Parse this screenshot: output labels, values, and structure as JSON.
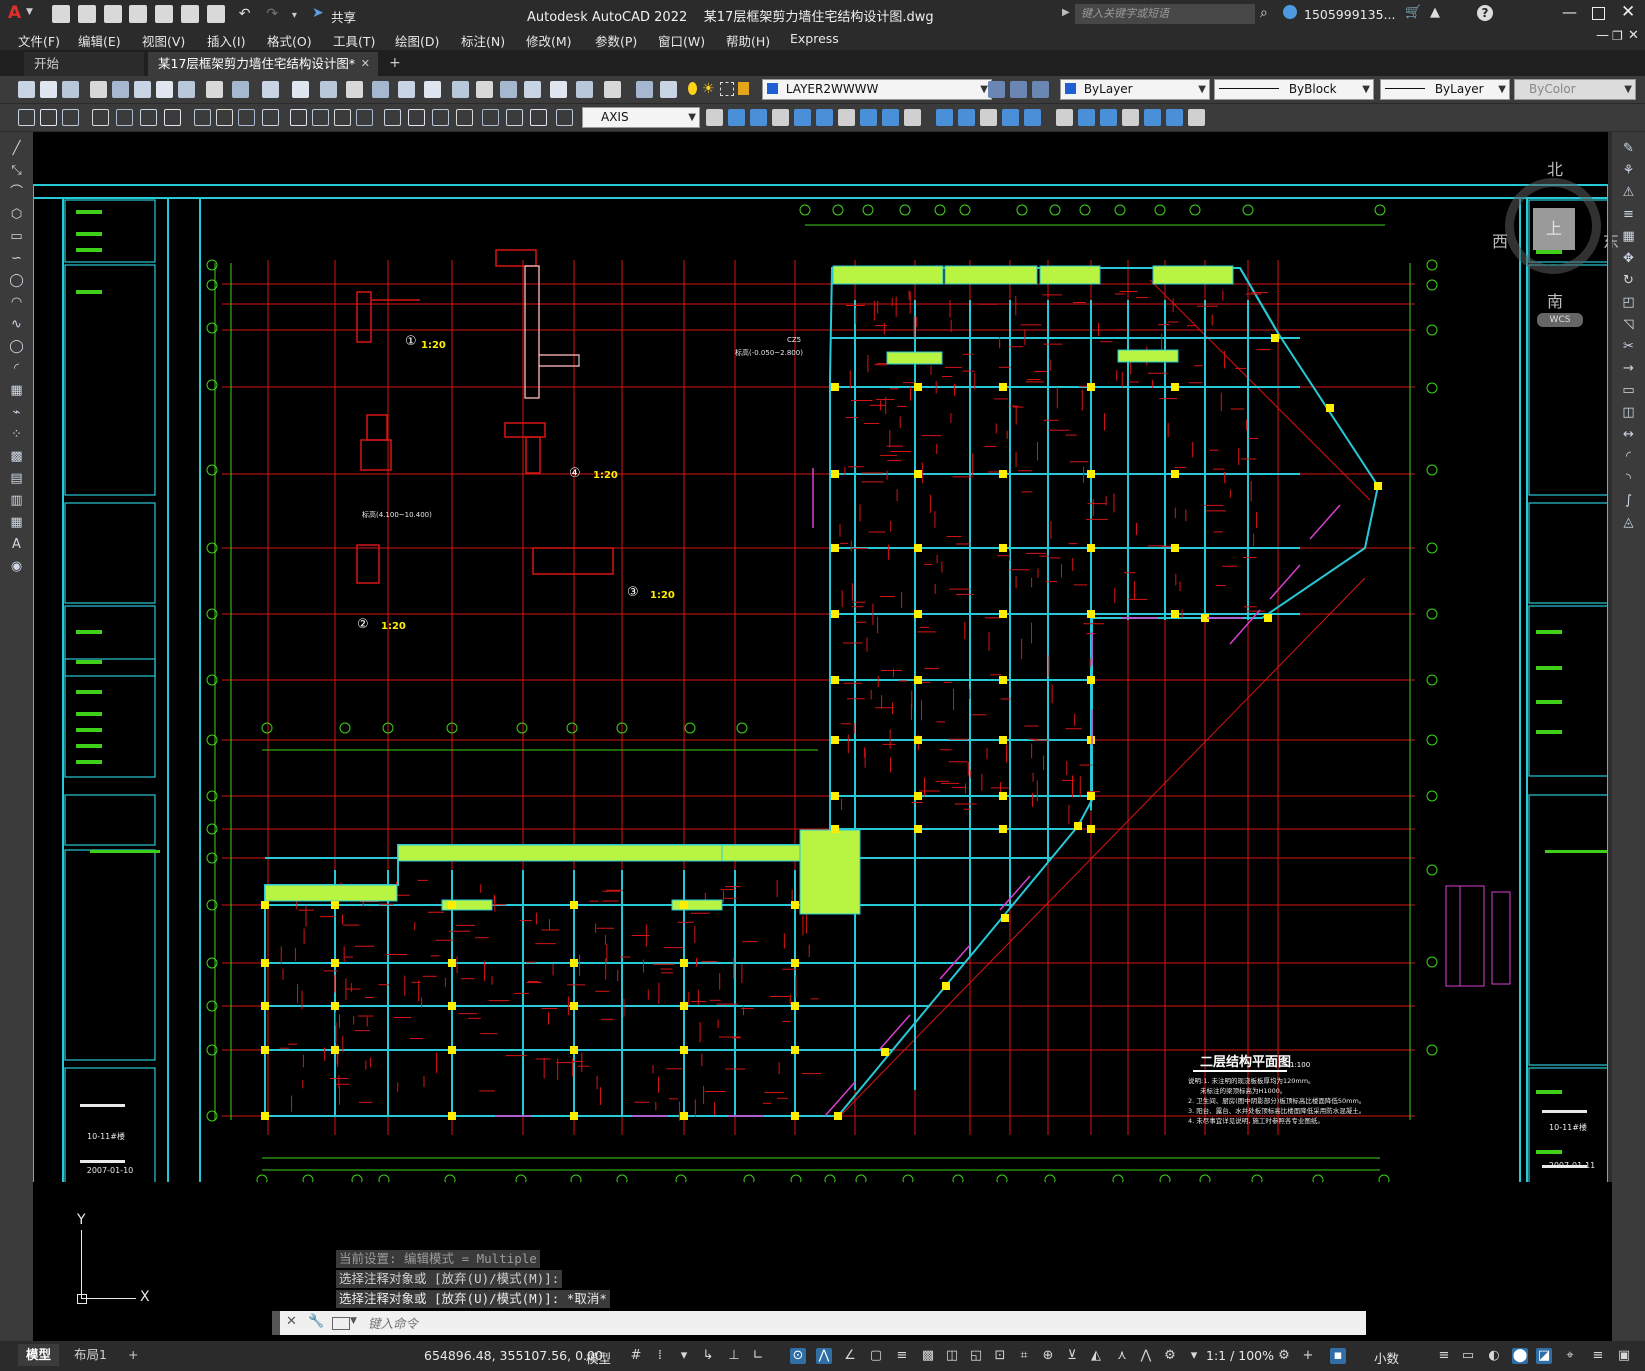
{
  "app": {
    "title": "Autodesk AutoCAD 2022    某17层框架剪力墙住宅结构设计图.dwg",
    "logo_letter": "A",
    "share_label": "共享",
    "search_placeholder": "键入关键字或短语",
    "user": "1505999135...",
    "help": "?"
  },
  "menu": [
    "文件(F)",
    "编辑(E)",
    "视图(V)",
    "插入(I)",
    "格式(O)",
    "工具(T)",
    "绘图(D)",
    "标注(N)",
    "修改(M)",
    "参数(P)",
    "窗口(W)",
    "帮助(H)",
    "Express"
  ],
  "tabs": {
    "start": "开始",
    "active": "某17层框架剪力墙住宅结构设计图*",
    "add": "+"
  },
  "layer_toolbar": {
    "layer": "LAYER2WWWW",
    "color": "ByLayer",
    "linetype": "ByBlock",
    "lineweight": "ByLayer",
    "plotstyle": "ByColor"
  },
  "dim_toolbar": {
    "dimstyle": "AXIS"
  },
  "viewcube": {
    "north": "北",
    "south": "南",
    "west": "西",
    "east": "东",
    "top": "上",
    "wcs": "WCS"
  },
  "drawing": {
    "plan_title": "二层结构平面图",
    "plan_scale": "1:100",
    "notes": [
      "说明:1. 未注明的现浇板板厚均为120mm。",
      "未标注的梁顶标高为H1000。",
      "2. 卫生间、厨房(图中阴影部分)板顶标高比楼面降低50mm。",
      "3. 阳台、露台、水井处板顶标高比楼面降低采用防水混凝土。",
      "4. 未尽事宜详见说明, 施工时参照各专业图纸。"
    ],
    "details": [
      {
        "num": "①",
        "scale": "1:20"
      },
      {
        "num": "②",
        "scale": "1:20"
      },
      {
        "num": "③",
        "scale": "1:20"
      },
      {
        "num": "④",
        "scale": "1:20"
      }
    ],
    "section_label": "标高(4.100~10.400)",
    "cz_label": "CZ5",
    "cz_range": "标高(-0.050~2.800)",
    "titleblock_dates": [
      "2007-01-10",
      "2007-01-11"
    ],
    "titleblock_code": "10-11#楼"
  },
  "ucs": {
    "y": "Y",
    "x": "X"
  },
  "command": {
    "history": [
      "当前设置: 编辑模式 = Multiple",
      "选择注释对象或 [放弃(U)/模式(M)]:",
      "选择注释对象或 [放弃(U)/模式(M)]: *取消*"
    ],
    "placeholder": "键入命令"
  },
  "status": {
    "model_tab": "模型",
    "layout_tab": "布局1",
    "add_tab": "+",
    "coords": "654896.48, 355107.56, 0.00",
    "model_btn": "模型",
    "scale": "1:1 / 100%",
    "units": "小数"
  },
  "colors": {
    "cyan": "#27c9d6",
    "red": "#d81414",
    "yellow": "#ffee00",
    "green": "#3fd11a",
    "lime": "#b8f442",
    "magenta": "#d93fd0",
    "white": "#e9e9e9",
    "bg": "#000000",
    "toolbar": "#3b3b3b"
  }
}
